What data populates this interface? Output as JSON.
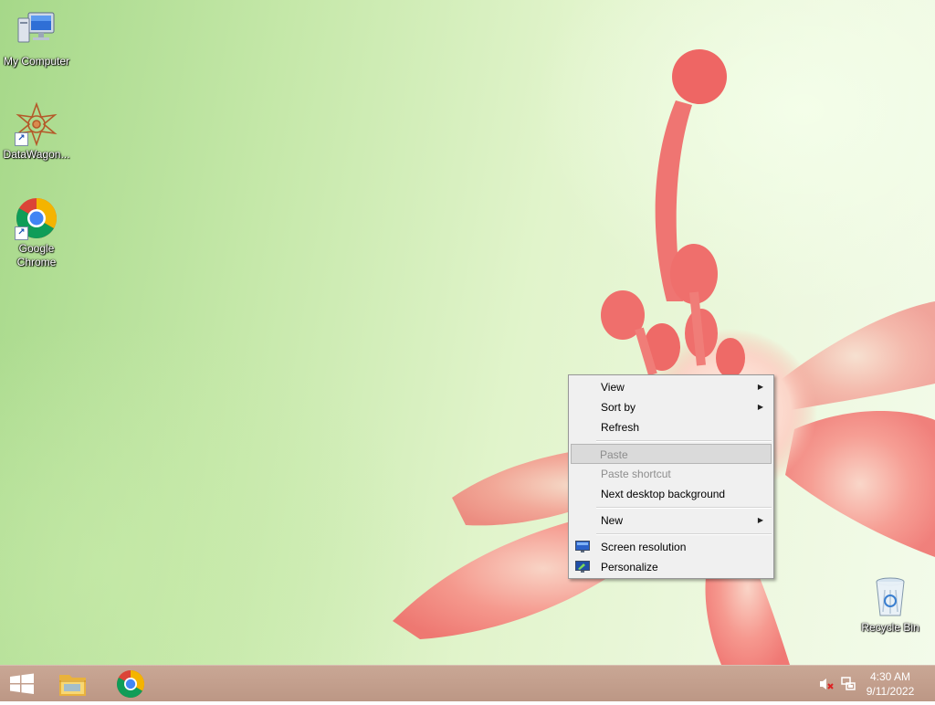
{
  "desktop": {
    "icons": [
      {
        "label": "My Computer",
        "icon": "computer-icon"
      },
      {
        "label": "DataWagon...",
        "icon": "datawagon-icon"
      },
      {
        "label": "Google Chrome",
        "icon": "chrome-icon"
      },
      {
        "label": "Recycle Bin",
        "icon": "recycle-bin-icon"
      }
    ]
  },
  "context_menu": {
    "items": [
      {
        "label": "View",
        "submenu": true,
        "enabled": true
      },
      {
        "label": "Sort by",
        "submenu": true,
        "enabled": true
      },
      {
        "label": "Refresh",
        "enabled": true
      },
      {
        "label": "Paste",
        "enabled": false,
        "highlighted": true
      },
      {
        "label": "Paste shortcut",
        "enabled": false
      },
      {
        "label": "Next desktop background",
        "enabled": true
      },
      {
        "label": "New",
        "submenu": true,
        "enabled": true
      },
      {
        "label": "Screen resolution",
        "enabled": true,
        "icon": "display-icon"
      },
      {
        "label": "Personalize",
        "enabled": true,
        "icon": "personalize-icon"
      }
    ]
  },
  "taskbar": {
    "pinned": [
      {
        "name": "Start",
        "icon": "windows-logo-icon"
      },
      {
        "name": "File Explorer",
        "icon": "folder-icon"
      },
      {
        "name": "Google Chrome",
        "icon": "chrome-icon"
      }
    ],
    "tray": {
      "volume_icon": "volume-muted-icon",
      "network_icon": "network-icon",
      "time": "4:30 AM",
      "date": "9/11/2022"
    }
  },
  "colors": {
    "taskbar": "#c39f8d",
    "menu_bg": "#f0f0f0",
    "menu_highlight": "#dadada",
    "flower": "#f07a76"
  }
}
